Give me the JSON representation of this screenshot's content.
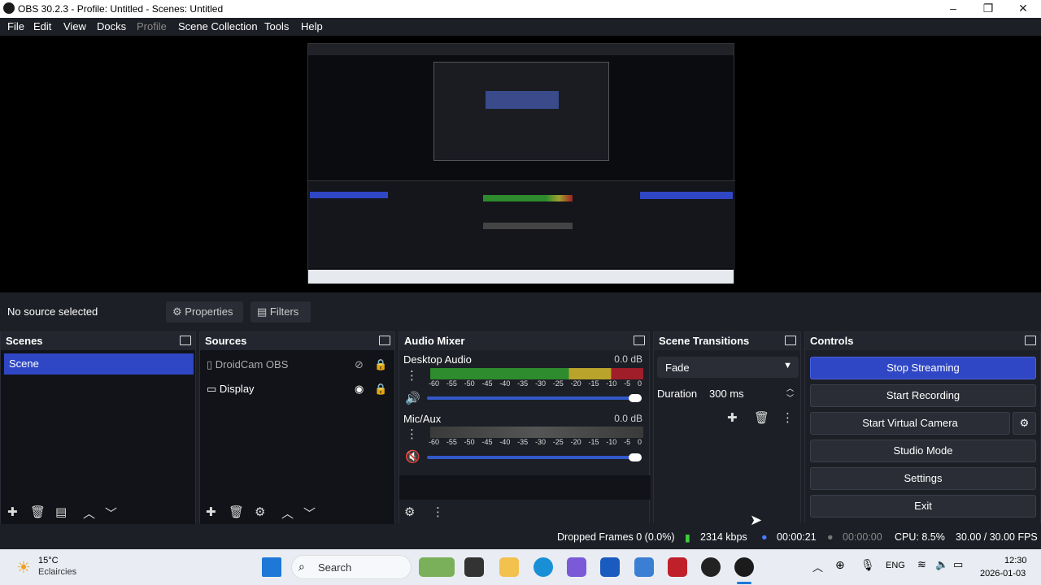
{
  "window": {
    "title": "OBS 30.2.3 - Profile: Untitled - Scenes: Untitled",
    "minimize_icon": "minimize-icon",
    "maximize_icon": "restore-icon",
    "close_icon": "close-icon"
  },
  "menu": [
    "File",
    "Edit",
    "View",
    "Docks",
    "Profile",
    "Scene Collection",
    "Tools",
    "Help"
  ],
  "context_bar": {
    "no_source": "No source selected",
    "properties": "Properties",
    "filters": "Filters"
  },
  "scenes": {
    "title": "Scenes",
    "items": [
      "Scene"
    ]
  },
  "sources": {
    "title": "Sources",
    "items": [
      {
        "name": "DroidCam OBS",
        "visible": false
      },
      {
        "name": "Display",
        "visible": true
      }
    ]
  },
  "audio_mixer": {
    "title": "Audio Mixer",
    "channels": [
      {
        "name": "Desktop Audio",
        "level": "0.0 dB",
        "muted": false
      },
      {
        "name": "Mic/Aux",
        "level": "0.0 dB",
        "muted": true
      }
    ],
    "ticks": [
      "-60",
      "-55",
      "-50",
      "-45",
      "-40",
      "-35",
      "-30",
      "-25",
      "-20",
      "-15",
      "-10",
      "-5",
      "0"
    ]
  },
  "transitions": {
    "title": "Scene Transitions",
    "selected": "Fade",
    "duration_label": "Duration",
    "duration_value": "300 ms"
  },
  "controls": {
    "title": "Controls",
    "buttons": [
      "Stop Streaming",
      "Start Recording",
      "Start Virtual Camera",
      "Studio Mode",
      "Settings",
      "Exit"
    ]
  },
  "status": {
    "dropped": "Dropped Frames 0 (0.0%)",
    "kbps": "2314 kbps",
    "stream_time": "00:00:21",
    "rec_time": "00:00:00",
    "cpu": "CPU: 8.5%",
    "fps": "30.00 / 30.00 FPS"
  },
  "taskbar": {
    "weather_temp": "15°C",
    "weather_desc": "Eclaircies",
    "search": "Search",
    "lang": "ENG",
    "time": "12:30",
    "date": "2026-01-03"
  },
  "colors": {
    "accent": "#2f47c4",
    "bg": "#1d1f26",
    "panel": "#121318"
  }
}
